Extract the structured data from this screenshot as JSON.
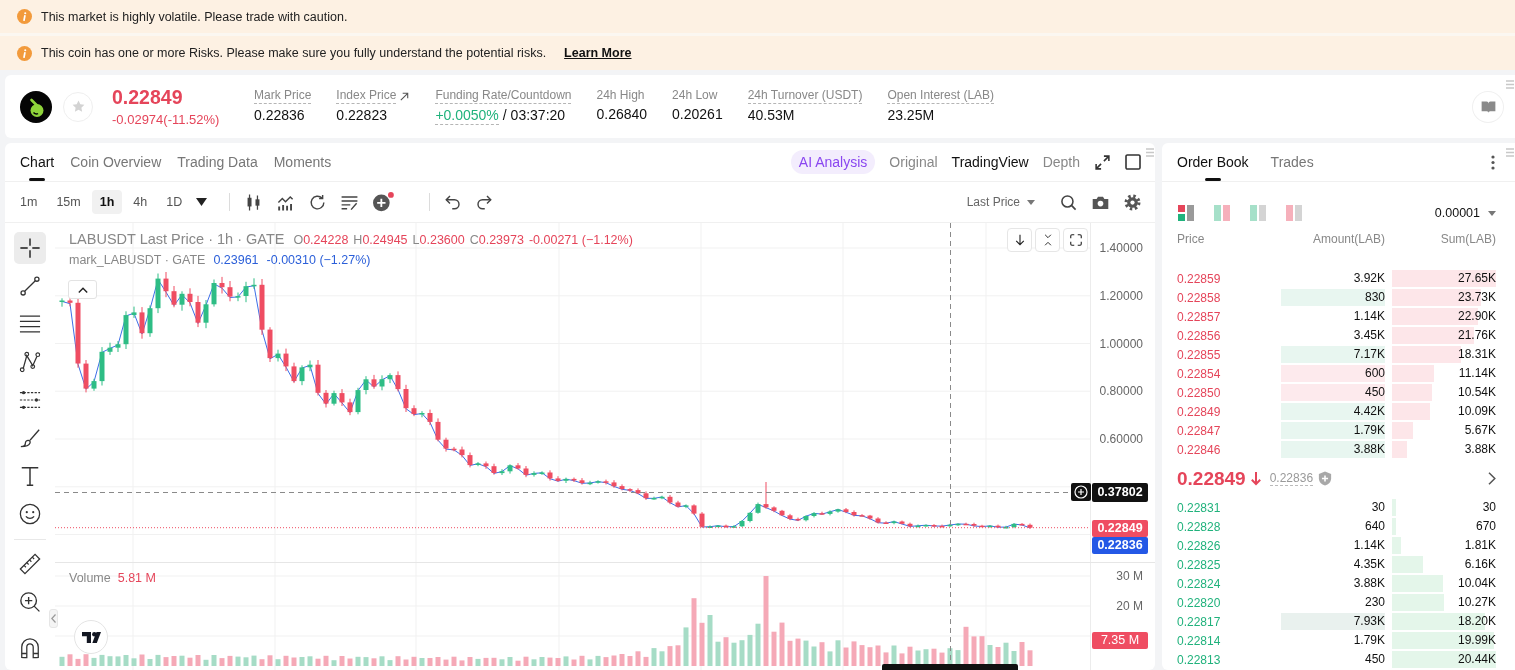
{
  "alerts": [
    {
      "text": "This market is highly volatile. Please trade with caution."
    },
    {
      "text": "This coin has one or more Risks. Please make sure you fully understand the potential risks.",
      "link": "Learn More"
    }
  ],
  "ticker": {
    "favorite": false,
    "price": "0.22849",
    "change": "-0.02974(-11.52%)",
    "falling": true,
    "stats": [
      {
        "label": "Mark Price",
        "dotted": true,
        "link": false,
        "value": "0.22836"
      },
      {
        "label": "Index Price",
        "dotted": true,
        "link": true,
        "value": "0.22823"
      },
      {
        "label": "Funding Rate/Countdown",
        "dotted": true,
        "link": false,
        "value": "+0.0050%",
        "color": "#20b27c",
        "countdown": "/ 03:37:20"
      },
      {
        "label": "24h High",
        "dotted": false,
        "link": false,
        "value": "0.26840"
      },
      {
        "label": "24h Low",
        "dotted": false,
        "link": false,
        "value": "0.20261"
      },
      {
        "label": "24h Turnover (USDT)",
        "dotted": true,
        "link": false,
        "value": "40.53M"
      },
      {
        "label": "Open Interest (LAB)",
        "dotted": true,
        "link": false,
        "value": "23.25M"
      }
    ]
  },
  "chart": {
    "tabs": [
      {
        "label": "Chart",
        "selected": true
      },
      {
        "label": "Coin Overview",
        "selected": false
      },
      {
        "label": "Trading Data",
        "selected": false
      },
      {
        "label": "Moments",
        "selected": false
      }
    ],
    "views": [
      {
        "label": "AI Analysis",
        "kind": "ai",
        "selected": false
      },
      {
        "label": "Original",
        "kind": "plain",
        "selected": false
      },
      {
        "label": "TradingView",
        "kind": "plain",
        "selected": true
      },
      {
        "label": "Depth",
        "kind": "plain",
        "selected": false
      }
    ],
    "intervals": [
      {
        "label": "1m",
        "selected": false
      },
      {
        "label": "15m",
        "selected": false
      },
      {
        "label": "1h",
        "selected": true
      },
      {
        "label": "4h",
        "selected": false
      },
      {
        "label": "1D",
        "selected": false
      }
    ],
    "price_source": "Last Price",
    "tool_groups": [
      [
        {
          "kind": "crosshair",
          "selected": true
        },
        {
          "kind": "trend-line",
          "selected": false
        },
        {
          "kind": "horizontal-lines",
          "selected": false
        },
        {
          "kind": "pattern",
          "selected": false
        },
        {
          "kind": "channel",
          "selected": false
        },
        {
          "kind": "brush",
          "selected": false
        },
        {
          "kind": "text",
          "selected": false
        },
        {
          "kind": "emoji",
          "selected": false
        }
      ],
      [
        {
          "kind": "ruler",
          "selected": false
        },
        {
          "kind": "zoom-in",
          "selected": false
        },
        {
          "kind": "magnet",
          "selected": false
        }
      ]
    ],
    "legend": {
      "title": "LABUSDT Last Price · 1h · GATE",
      "ohlc": [
        {
          "key": "O",
          "value": "0.24228"
        },
        {
          "key": "H",
          "value": "0.24945"
        },
        {
          "key": "L",
          "value": "0.23600"
        },
        {
          "key": "C",
          "value": "0.23973"
        }
      ],
      "change": "-0.00271 (−1.12%)",
      "falling": true
    },
    "mark_legend": {
      "title": "mark_LABUSDT · GATE",
      "value": "0.23961",
      "change": "-0.00310 (−1.27%)"
    },
    "price_axis": [
      "1.40000",
      "1.20000",
      "1.00000",
      "0.80000",
      "0.60000"
    ],
    "crosshair_price": "0.37802",
    "last_price": "0.22849",
    "mark_price": "0.22836",
    "volume": {
      "label": "Volume",
      "value": "5.81 M",
      "axis": [
        "30 M",
        "20 M"
      ],
      "last": "7.35 M"
    }
  },
  "order_book": {
    "tabs": [
      {
        "label": "Order Book",
        "selected": true
      },
      {
        "label": "Trades",
        "selected": false
      }
    ],
    "layouts": [
      {
        "kind": "stacked",
        "selected": true
      },
      {
        "kind": "side-by-side",
        "selected": false
      },
      {
        "kind": "bids",
        "selected": false
      },
      {
        "kind": "asks",
        "selected": false
      }
    ],
    "precision": "0.00001",
    "columns": [
      "Price",
      "Amount(LAB)",
      "Sum(LAB)"
    ],
    "asks": [
      {
        "price": "0.22859",
        "amount": "3.92K",
        "sum": "27.65K"
      },
      {
        "price": "0.22858",
        "amount": "830",
        "sum": "23.73K",
        "color": "#e8f6f0"
      },
      {
        "price": "0.22857",
        "amount": "1.14K",
        "sum": "22.90K"
      },
      {
        "price": "0.22856",
        "amount": "3.45K",
        "sum": "21.76K"
      },
      {
        "price": "0.22855",
        "amount": "7.17K",
        "sum": "18.31K",
        "color": "#e8f6f0"
      },
      {
        "price": "0.22854",
        "amount": "600",
        "sum": "11.14K",
        "color": "#fdeaed"
      },
      {
        "price": "0.22850",
        "amount": "450",
        "sum": "10.54K",
        "color": "#fdeaed"
      },
      {
        "price": "0.22849",
        "amount": "4.42K",
        "sum": "10.09K",
        "color": "#e8f6f0"
      },
      {
        "price": "0.22847",
        "amount": "1.79K",
        "sum": "5.67K",
        "color": "#e8f6f0"
      },
      {
        "price": "0.22846",
        "amount": "3.88K",
        "sum": "3.88K",
        "color": "#e8f6f0"
      }
    ],
    "last": {
      "price": "0.22849",
      "falling": true,
      "mark": "0.22836"
    },
    "bids": [
      {
        "price": "0.22831",
        "amount": "30",
        "sum": "30"
      },
      {
        "price": "0.22828",
        "amount": "640",
        "sum": "670"
      },
      {
        "price": "0.22826",
        "amount": "1.14K",
        "sum": "1.81K"
      },
      {
        "price": "0.22825",
        "amount": "4.35K",
        "sum": "6.16K"
      },
      {
        "price": "0.22824",
        "amount": "3.88K",
        "sum": "10.04K"
      },
      {
        "price": "0.22820",
        "amount": "230",
        "sum": "10.27K"
      },
      {
        "price": "0.22817",
        "amount": "7.93K",
        "sum": "18.20K",
        "color": "#e9f1ee"
      },
      {
        "price": "0.22814",
        "amount": "1.79K",
        "sum": "19.99K"
      },
      {
        "price": "0.22813",
        "amount": "450",
        "sum": "20.44K"
      }
    ]
  }
}
